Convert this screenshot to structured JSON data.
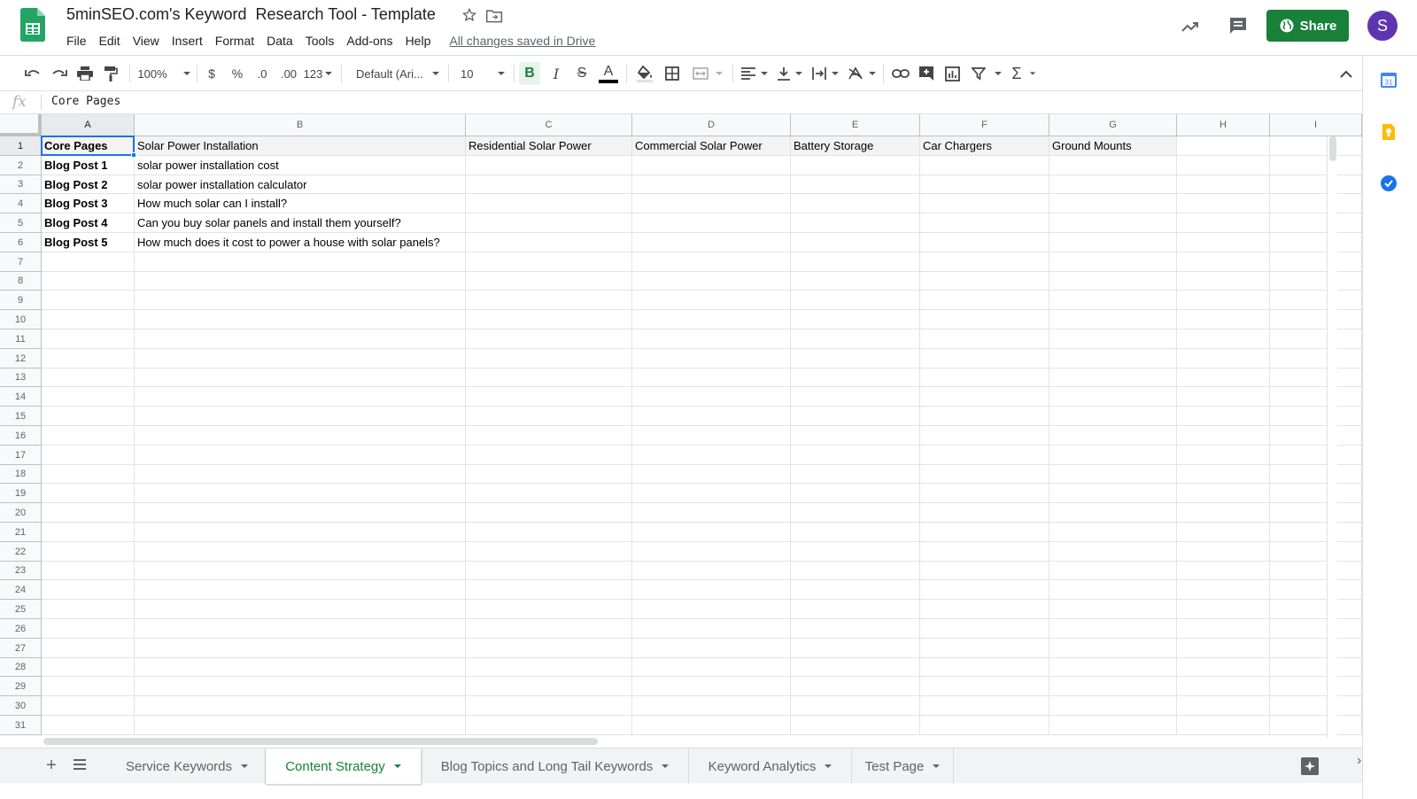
{
  "header": {
    "title": "5minSEO.com's Keyword  Research Tool - Template",
    "menus": [
      "File",
      "Edit",
      "View",
      "Insert",
      "Format",
      "Data",
      "Tools",
      "Add-ons",
      "Help"
    ],
    "save_status": "All changes saved in Drive",
    "share_label": "Share",
    "avatar_letter": "S",
    "share_color": "#188038",
    "avatar_color": "#5e35b1"
  },
  "toolbar": {
    "zoom": "100%",
    "currency": "$",
    "percent": "%",
    "decrease_decimals": ".0",
    "increase_decimals": ".00",
    "more_formats": "123",
    "font": "Default (Ari...",
    "font_size": "10",
    "bold": "B",
    "italic": "I",
    "strikethrough": "S",
    "text_color": "A",
    "sum": "Σ",
    "icons": [
      "undo-icon",
      "redo-icon",
      "print-icon",
      "paint-format-icon",
      "fill-color-icon",
      "borders-icon",
      "merge-cells-icon",
      "horizontal-align-icon",
      "vertical-align-icon",
      "text-wrap-icon",
      "text-rotation-icon",
      "link-icon",
      "comment-icon",
      "chart-icon",
      "filter-icon",
      "functions-icon",
      "collapse-icon"
    ]
  },
  "formula_bar": {
    "fx": "fx",
    "content": "Core Pages"
  },
  "grid": {
    "columns": [
      "A",
      "B",
      "C",
      "D",
      "E",
      "F",
      "G",
      "H",
      "I"
    ],
    "row_count": 31,
    "selected_cell": "A1",
    "rows": [
      [
        "Core Pages",
        "Solar Power Installation",
        "Residential Solar Power",
        "Commercial Solar Power",
        "Battery Storage",
        "Car Chargers",
        "Ground Mounts",
        "",
        ""
      ],
      [
        "Blog Post 1",
        "solar power installation cost",
        "",
        "",
        "",
        "",
        "",
        "",
        ""
      ],
      [
        "Blog Post 2",
        "solar power installation calculator",
        "",
        "",
        "",
        "",
        "",
        "",
        ""
      ],
      [
        "Blog Post 3",
        "How much solar can I install?",
        "",
        "",
        "",
        "",
        "",
        "",
        ""
      ],
      [
        "Blog Post 4",
        "Can you buy solar panels and install them yourself?",
        "",
        "",
        "",
        "",
        "",
        "",
        ""
      ],
      [
        "Blog Post 5",
        "How much does it cost to power a house with solar panels?",
        "",
        "",
        "",
        "",
        "",
        "",
        ""
      ]
    ],
    "header_row_fill": "#f3f3f3",
    "selection_color": "#1a73e8"
  },
  "sheets": {
    "tabs": [
      "Service Keywords",
      "Content Strategy",
      "Blog Topics and Long Tail Keywords",
      "Keyword Analytics",
      "Test Page"
    ],
    "active": "Content Strategy",
    "active_color": "#188038"
  },
  "sidepanel": {
    "icons": [
      "calendar-icon",
      "keep-icon",
      "tasks-icon"
    ],
    "calendar_day": "31"
  }
}
